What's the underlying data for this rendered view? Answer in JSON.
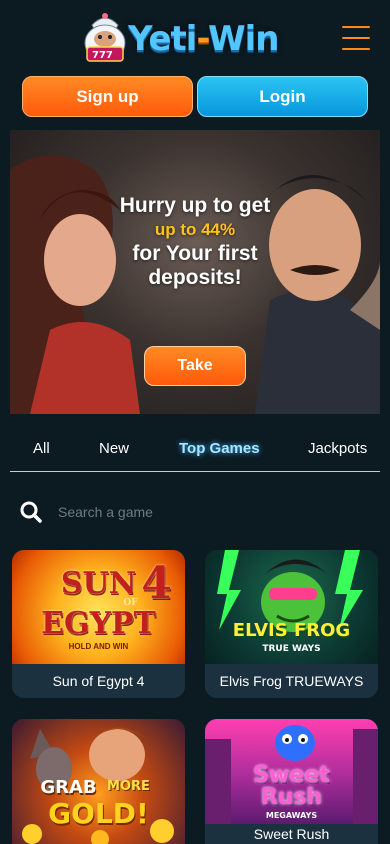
{
  "header": {
    "logo_text_left": "Yeti",
    "logo_text_dash": "-",
    "logo_text_right": "Win"
  },
  "auth": {
    "signup_label": "Sign up",
    "login_label": "Login"
  },
  "banner": {
    "line1": "Hurry up to get",
    "highlight": "up to 44%",
    "line2": "for Your first",
    "line3": "deposits!",
    "cta_label": "Take"
  },
  "tabs": [
    {
      "label": "All",
      "active": false
    },
    {
      "label": "New",
      "active": false
    },
    {
      "label": "Top Games",
      "active": true
    },
    {
      "label": "Jackpots",
      "active": false
    }
  ],
  "search": {
    "placeholder": "Search a game"
  },
  "games": [
    {
      "name": "Sun of Egypt 4",
      "art_top": "SUN",
      "art_mid": "EGYPT",
      "art_num": "4",
      "art_of": "OF",
      "art_sub": "HOLD AND WIN"
    },
    {
      "name": "Elvis Frog TRUEWAYS",
      "art_top": "ELVIS FROG",
      "art_sub": "TRUE WAYS"
    },
    {
      "name": "",
      "art_top": "GRAB",
      "art_of": "MORE",
      "art_mid": "GOLD!"
    },
    {
      "name": "Sweet Rush",
      "art_top": "Sweet",
      "art_mid": "Rush",
      "art_sub": "MEGAWAYS"
    }
  ],
  "colors": {
    "background": "#0c1a22",
    "accent_orange": "#ff6a12",
    "accent_blue": "#0ea8e8",
    "highlight_yellow": "#ffc21c"
  }
}
